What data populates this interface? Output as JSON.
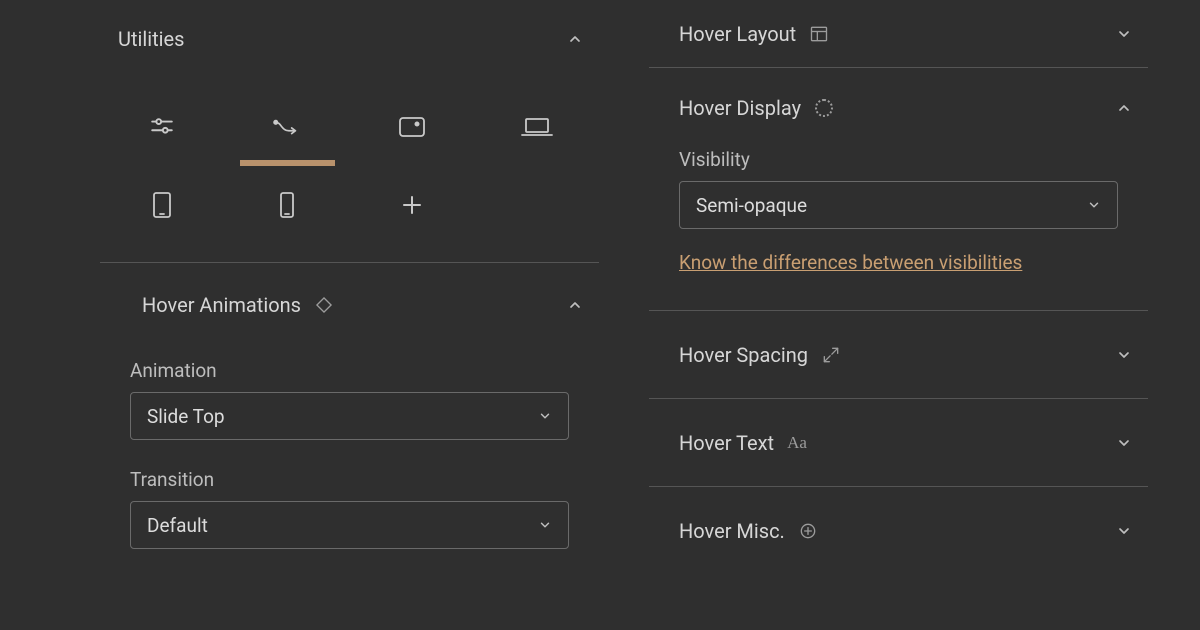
{
  "left": {
    "utilities": {
      "title": "Utilities",
      "expanded": true
    },
    "hover_anim": {
      "title": "Hover Animations",
      "expanded": true,
      "animation_label": "Animation",
      "animation_value": "Slide Top",
      "transition_label": "Transition",
      "transition_value": "Default"
    }
  },
  "right": {
    "hover_layout": {
      "title": "Hover Layout",
      "expanded": false
    },
    "hover_display": {
      "title": "Hover Display",
      "expanded": true,
      "visibility_label": "Visibility",
      "visibility_value": "Semi-opaque",
      "help_link": "Know the differences between visibilities"
    },
    "hover_spacing": {
      "title": "Hover Spacing",
      "expanded": false
    },
    "hover_text": {
      "title": "Hover Text",
      "expanded": false
    },
    "hover_misc": {
      "title": "Hover Misc.",
      "expanded": false
    }
  }
}
